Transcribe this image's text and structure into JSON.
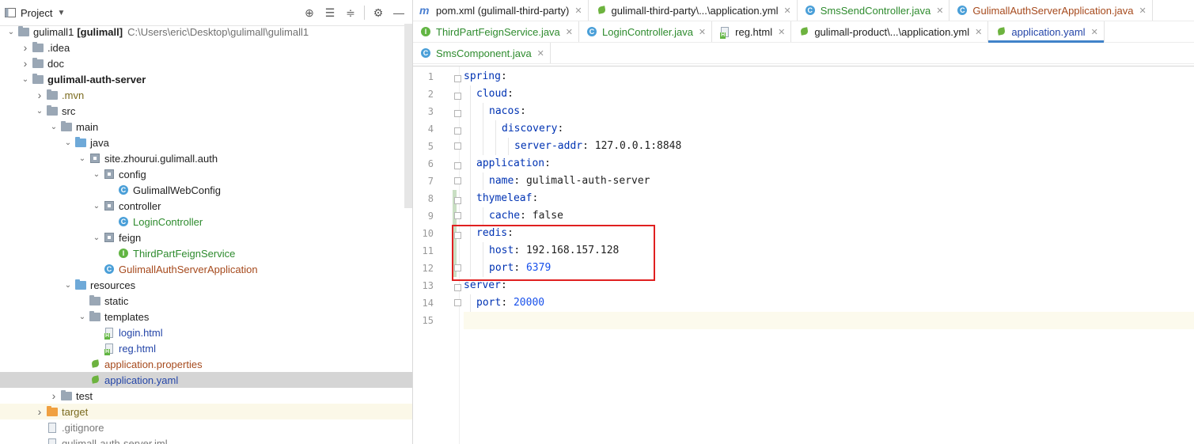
{
  "project_panel": {
    "title": "Project",
    "toolbar_icons": [
      "locate-icon",
      "collapse-all-icon",
      "expand-all-icon",
      "settings-icon",
      "minimize-icon"
    ],
    "tree": [
      {
        "level": 0,
        "expanded": true,
        "icon": "module-folder-icon",
        "label": "gulimall1",
        "extra": "[gulimall]",
        "path": "C:\\Users\\eric\\Desktop\\gulimall\\gulimall1",
        "style": "normal"
      },
      {
        "level": 1,
        "expanded": false,
        "icon": "folder-icon",
        "label": ".idea",
        "style": "normal"
      },
      {
        "level": 1,
        "expanded": false,
        "icon": "folder-icon",
        "label": "doc",
        "style": "normal"
      },
      {
        "level": 1,
        "expanded": true,
        "icon": "module-folder-icon",
        "label": "gulimall-auth-server",
        "style": "bold"
      },
      {
        "level": 2,
        "expanded": false,
        "icon": "folder-icon",
        "label": ".mvn",
        "style": "olive"
      },
      {
        "level": 2,
        "expanded": true,
        "icon": "folder-icon",
        "label": "src",
        "style": "normal"
      },
      {
        "level": 3,
        "expanded": true,
        "icon": "folder-icon",
        "label": "main",
        "style": "normal"
      },
      {
        "level": 4,
        "expanded": true,
        "icon": "source-folder-icon",
        "label": "java",
        "style": "normal"
      },
      {
        "level": 5,
        "expanded": true,
        "icon": "package-icon",
        "label": "site.zhourui.gulimall.auth",
        "style": "normal"
      },
      {
        "level": 6,
        "expanded": true,
        "icon": "package-icon",
        "label": "config",
        "style": "normal"
      },
      {
        "level": 7,
        "expanded": null,
        "icon": "class-icon",
        "label": "GulimallWebConfig",
        "style": "normal"
      },
      {
        "level": 6,
        "expanded": true,
        "icon": "package-icon",
        "label": "controller",
        "style": "normal"
      },
      {
        "level": 7,
        "expanded": null,
        "icon": "class-icon",
        "label": "LoginController",
        "style": "green"
      },
      {
        "level": 6,
        "expanded": true,
        "icon": "package-icon",
        "label": "feign",
        "style": "normal"
      },
      {
        "level": 7,
        "expanded": null,
        "icon": "interface-icon",
        "label": "ThirdPartFeignService",
        "style": "green"
      },
      {
        "level": 6,
        "expanded": null,
        "icon": "spring-class-icon",
        "label": "GulimallAuthServerApplication",
        "style": "red"
      },
      {
        "level": 4,
        "expanded": true,
        "icon": "resources-folder-icon",
        "label": "resources",
        "style": "normal"
      },
      {
        "level": 5,
        "expanded": null,
        "icon": "folder-icon",
        "label": "static",
        "style": "normal"
      },
      {
        "level": 5,
        "expanded": true,
        "icon": "folder-icon",
        "label": "templates",
        "style": "normal"
      },
      {
        "level": 6,
        "expanded": null,
        "icon": "html-file-icon",
        "label": "login.html",
        "style": "blue"
      },
      {
        "level": 6,
        "expanded": null,
        "icon": "html-file-icon",
        "label": "reg.html",
        "style": "blue"
      },
      {
        "level": 5,
        "expanded": null,
        "icon": "spring-config-icon",
        "label": "application.properties",
        "style": "red"
      },
      {
        "level": 5,
        "expanded": null,
        "icon": "spring-config-icon",
        "label": "application.yaml",
        "style": "blue",
        "selected": true
      },
      {
        "level": 3,
        "expanded": false,
        "icon": "folder-icon",
        "label": "test",
        "style": "normal"
      },
      {
        "level": 2,
        "expanded": false,
        "icon": "excluded-folder-icon",
        "label": "target",
        "style": "olive",
        "highlight": true
      },
      {
        "level": 2,
        "expanded": null,
        "icon": "gitignore-file-icon",
        "label": ".gitignore",
        "style": "gray"
      },
      {
        "level": 2,
        "expanded": null,
        "icon": "iml-file-icon",
        "label": "gulimall-auth-server.iml",
        "style": "gray"
      }
    ]
  },
  "editor_tabs": [
    [
      {
        "label": "pom.xml (gulimall-third-party)",
        "icon": "maven-icon",
        "style": "normal"
      },
      {
        "label": "gulimall-third-party\\...\\application.yml",
        "icon": "spring-config-icon",
        "style": "normal"
      },
      {
        "label": "SmsSendController.java",
        "icon": "class-icon",
        "style": "green"
      },
      {
        "label": "GulimallAuthServerApplication.java",
        "icon": "spring-class-icon",
        "style": "red"
      }
    ],
    [
      {
        "label": "ThirdPartFeignService.java",
        "icon": "interface-icon",
        "style": "green"
      },
      {
        "label": "LoginController.java",
        "icon": "class-icon",
        "style": "green"
      },
      {
        "label": "reg.html",
        "icon": "html-file-icon",
        "style": "normal"
      },
      {
        "label": "gulimall-product\\...\\application.yml",
        "icon": "spring-config-icon",
        "style": "normal"
      },
      {
        "label": "application.yaml",
        "icon": "spring-config-icon",
        "style": "blue",
        "active": true
      }
    ],
    [
      {
        "label": "SmsComponent.java",
        "icon": "class-icon",
        "style": "green"
      }
    ]
  ],
  "editor": {
    "lines": [
      {
        "num": "1",
        "indent": 0,
        "key": "spring",
        "value": ""
      },
      {
        "num": "2",
        "indent": 1,
        "key": "cloud",
        "value": ""
      },
      {
        "num": "3",
        "indent": 2,
        "key": "nacos",
        "value": ""
      },
      {
        "num": "4",
        "indent": 3,
        "key": "discovery",
        "value": ""
      },
      {
        "num": "5",
        "indent": 4,
        "key": "server-addr",
        "value": "127.0.0.1:8848"
      },
      {
        "num": "6",
        "indent": 1,
        "key": "application",
        "value": ""
      },
      {
        "num": "7",
        "indent": 2,
        "key": "name",
        "value": "gulimall-auth-server"
      },
      {
        "num": "8",
        "indent": 1,
        "key": "thymeleaf",
        "value": ""
      },
      {
        "num": "9",
        "indent": 2,
        "key": "cache",
        "value": "false"
      },
      {
        "num": "10",
        "indent": 1,
        "key": "redis",
        "value": ""
      },
      {
        "num": "11",
        "indent": 2,
        "key": "host",
        "value": "192.168.157.128"
      },
      {
        "num": "12",
        "indent": 2,
        "key": "port",
        "value": "6379",
        "numeric": true
      },
      {
        "num": "13",
        "indent": 0,
        "key": "server",
        "value": ""
      },
      {
        "num": "14",
        "indent": 1,
        "key": "port",
        "value": "20000",
        "numeric": true
      },
      {
        "num": "15",
        "indent": 0,
        "key": "",
        "value": "",
        "current": true
      }
    ],
    "annotation_color": "#e02020"
  }
}
